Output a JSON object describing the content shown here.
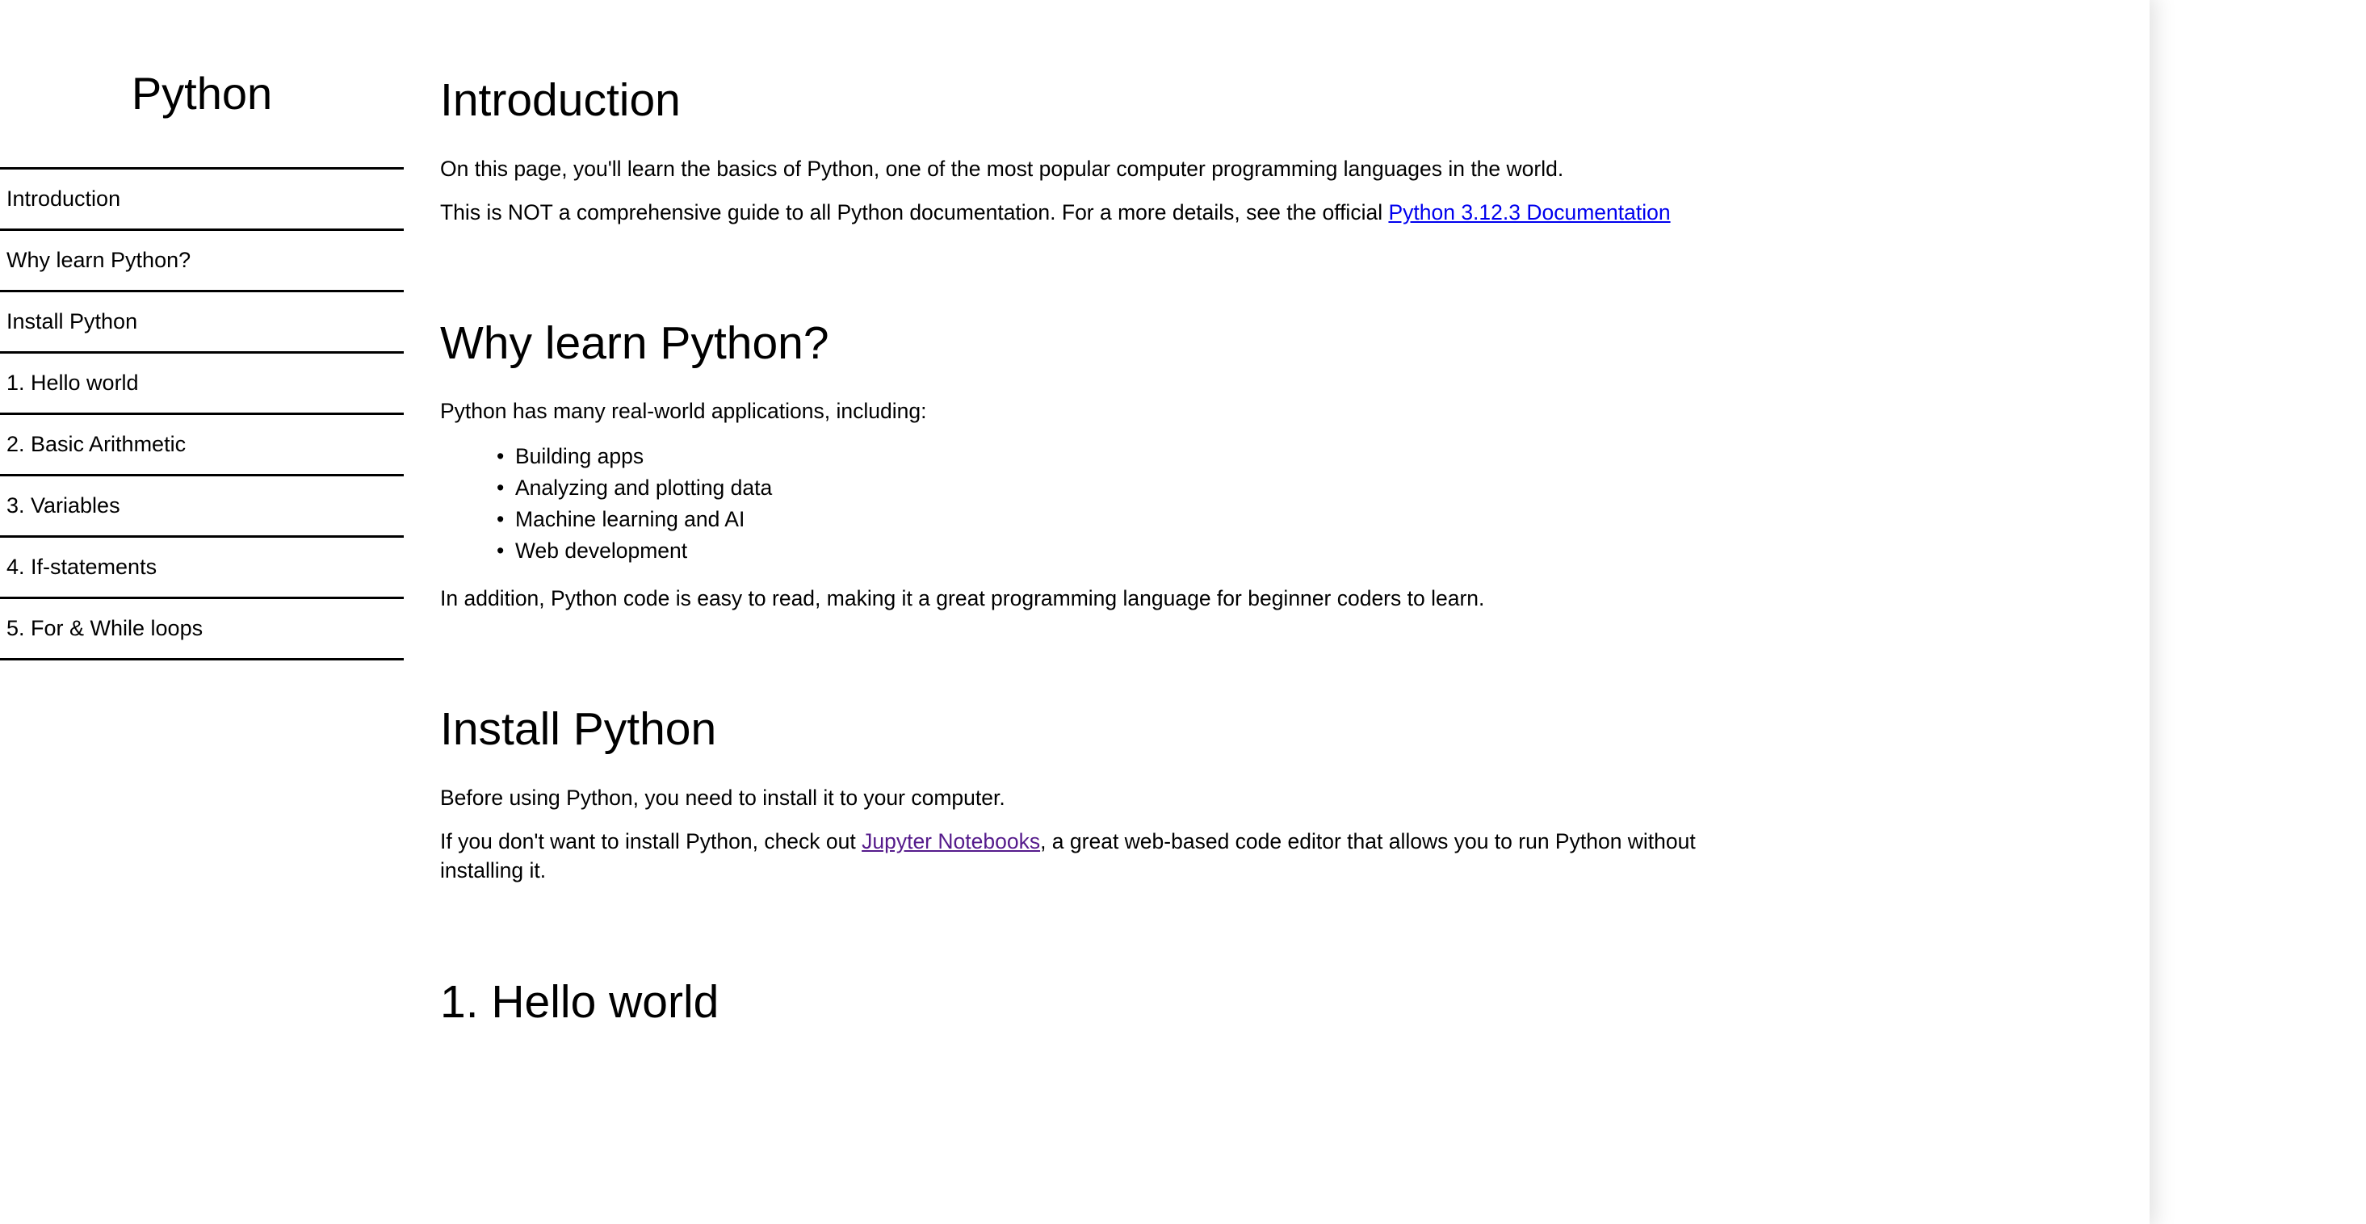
{
  "sidebar": {
    "title": "Python",
    "items": [
      {
        "label": "Introduction"
      },
      {
        "label": "Why learn Python?"
      },
      {
        "label": "Install Python"
      },
      {
        "label": "1. Hello world"
      },
      {
        "label": "2. Basic Arithmetic"
      },
      {
        "label": "3. Variables"
      },
      {
        "label": "4. If-statements"
      },
      {
        "label": "5. For & While loops"
      }
    ]
  },
  "content": {
    "introduction": {
      "heading": "Introduction",
      "paragraph_1": "On this page, you'll learn the basics of Python, one of the most popular computer programming languages in the world.",
      "paragraph_2_before_link": "This is NOT a comprehensive guide to all Python documentation. For a more details, see the official ",
      "paragraph_2_link": "Python 3.12.3 Documentation",
      "paragraph_2_after_link": ""
    },
    "why_learn": {
      "heading": "Why learn Python?",
      "intro": "Python has many real-world applications, including:",
      "bullet_glyph": "•",
      "bullets": [
        "Building apps",
        "Analyzing and plotting data",
        "Machine learning and AI",
        "Web development"
      ],
      "closing": "In addition, Python code is easy to read, making it a great programming language for beginner coders to learn."
    },
    "install": {
      "heading": "Install Python",
      "paragraph_1": "Before using Python, you need to install it to your computer.",
      "paragraph_2_before_link": "If you don't want to install Python, check out ",
      "paragraph_2_link": "Jupyter Notebooks",
      "paragraph_2_after_link": ", a great web-based code editor that allows you to run Python without installing it."
    },
    "hello_world": {
      "heading": "1. Hello world"
    }
  },
  "colors": {
    "link": "#0000ee",
    "link_visited": "#551a8b",
    "rule": "#000000",
    "text": "#000000",
    "background": "#ffffff"
  }
}
